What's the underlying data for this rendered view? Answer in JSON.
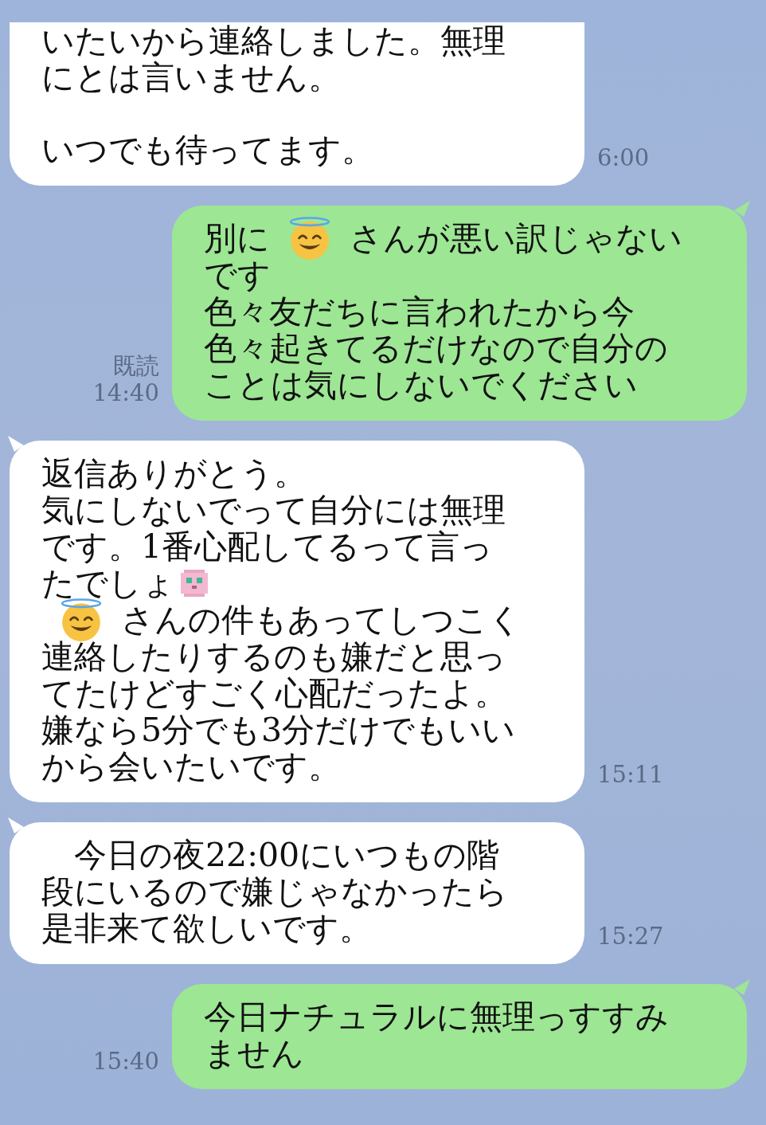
{
  "messages": [
    {
      "kind": "incoming",
      "paragraphs": [
        [
          [
            {
              "kind": "text",
              "text": "いたいから連絡しました。無理"
            }
          ],
          [
            {
              "kind": "text",
              "text": "にとは言いません。"
            }
          ]
        ],
        [
          [
            {
              "kind": "text",
              "text": "いつでも待ってます。"
            }
          ]
        ]
      ],
      "time": "6:00"
    },
    {
      "kind": "outgoing",
      "tail": true,
      "paragraphs": [
        [
          [
            {
              "kind": "text",
              "text": "別に"
            },
            {
              "kind": "sticker"
            },
            {
              "kind": "text",
              "text": "さんが悪い訳じゃない"
            }
          ],
          [
            {
              "kind": "text",
              "text": "です"
            }
          ],
          [
            {
              "kind": "text",
              "text": "色々友だちに言われたから今"
            }
          ],
          [
            {
              "kind": "text",
              "text": "色々起きてるだけなので自分の"
            }
          ],
          [
            {
              "kind": "text",
              "text": "ことは気にしないでください"
            }
          ]
        ]
      ],
      "read_label": "既読",
      "time": "14:40"
    },
    {
      "kind": "incoming",
      "paragraphs": [
        [
          [
            {
              "kind": "text",
              "text": "返信ありがとう。"
            }
          ],
          [
            {
              "kind": "text",
              "text": "気にしないでって自分には無理"
            }
          ],
          [
            {
              "kind": "text",
              "text": "です。1番心配してるって言っ"
            }
          ],
          [
            {
              "kind": "text",
              "text": "たでしょ"
            },
            {
              "kind": "pixel-icon"
            }
          ],
          [
            {
              "kind": "sticker"
            },
            {
              "kind": "text",
              "text": "さんの件もあってしつこく"
            }
          ],
          [
            {
              "kind": "text",
              "text": "連絡したりするのも嫌だと思っ"
            }
          ],
          [
            {
              "kind": "text",
              "text": "てたけどすごく心配だったよ。"
            }
          ],
          [
            {
              "kind": "text",
              "text": "嫌なら5分でも3分だけでもいい"
            }
          ],
          [
            {
              "kind": "text",
              "text": "から会いたいです。"
            }
          ]
        ]
      ],
      "tail": true,
      "time": "15:11"
    },
    {
      "kind": "incoming",
      "paragraphs": [
        [
          [
            {
              "kind": "text",
              "text": "　今日の夜22:00にいつもの階"
            }
          ],
          [
            {
              "kind": "text",
              "text": "段にいるので嫌じゃなかったら"
            }
          ],
          [
            {
              "kind": "text",
              "text": "是非来て欲しいです。"
            }
          ]
        ]
      ],
      "tail": true,
      "time": "15:27"
    },
    {
      "kind": "outgoing",
      "tail": true,
      "paragraphs": [
        [
          [
            {
              "kind": "text",
              "text": "今日ナチュラルに無理っすすみ"
            }
          ],
          [
            {
              "kind": "text",
              "text": "ません"
            }
          ]
        ]
      ],
      "time": "15:40"
    }
  ]
}
